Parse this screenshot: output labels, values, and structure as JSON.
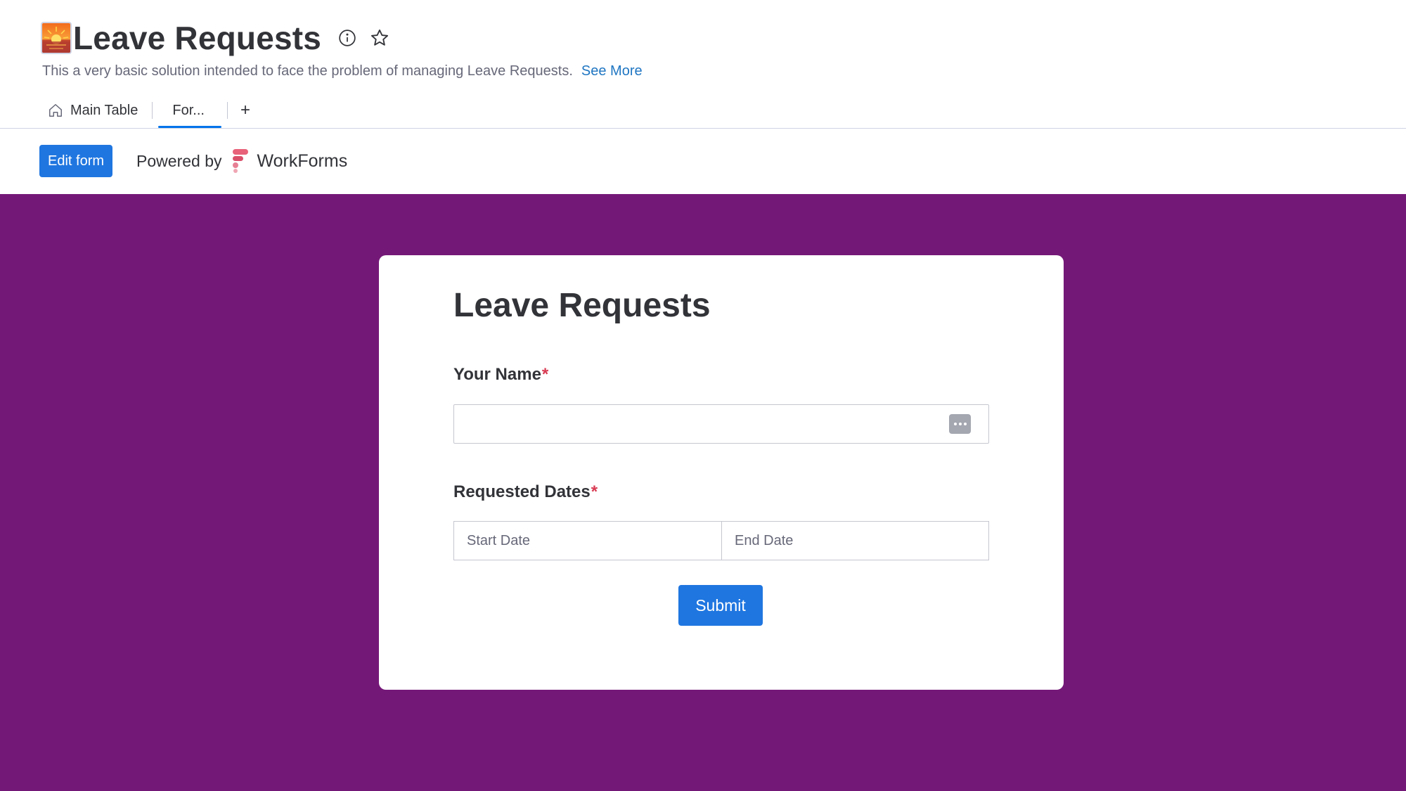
{
  "board": {
    "emoji_icon": "sunrise-emoji-icon",
    "title": "Leave Requests",
    "description": "This a very basic solution intended to face the problem of managing Leave Requests.",
    "see_more": "See More"
  },
  "tabs": {
    "items": [
      {
        "label": "Main Table",
        "icon": "home-icon",
        "active": false
      },
      {
        "label": "For...",
        "active": true
      }
    ],
    "add_label": "+"
  },
  "toolbar": {
    "edit_label": "Edit form",
    "powered_by": "Powered by",
    "brand": "WorkForms"
  },
  "form": {
    "background_color": "#741878",
    "title": "Leave Requests",
    "fields": {
      "name": {
        "label": "Your Name",
        "required_mark": "*",
        "value": "",
        "placeholder": ""
      },
      "dates": {
        "label": "Requested Dates",
        "required_mark": "*",
        "start_placeholder": "Start Date",
        "end_placeholder": "End Date"
      }
    },
    "submit_label": "Submit"
  },
  "colors": {
    "accent": "#1f76e0",
    "link": "#1f76c2",
    "required": "#d83a52"
  }
}
